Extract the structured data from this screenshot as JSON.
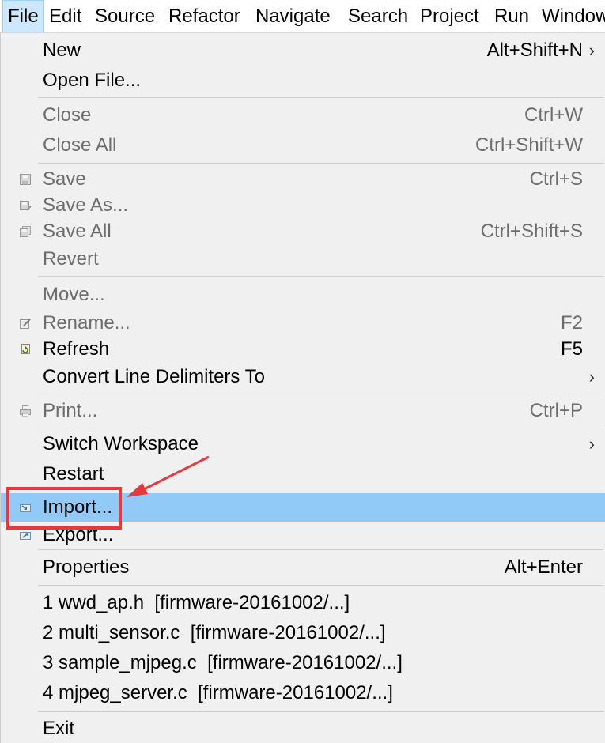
{
  "menubar": {
    "items": [
      "File",
      "Edit",
      "Source",
      "Refactor",
      "Navigate",
      "Search",
      "Project",
      "Run",
      "Window"
    ]
  },
  "menu": {
    "new": {
      "label": "New",
      "shortcut": "Alt+Shift+N"
    },
    "open_file": {
      "label": "Open File..."
    },
    "close": {
      "label": "Close",
      "shortcut": "Ctrl+W"
    },
    "close_all": {
      "label": "Close All",
      "shortcut": "Ctrl+Shift+W"
    },
    "save": {
      "label": "Save",
      "shortcut": "Ctrl+S"
    },
    "save_as": {
      "label": "Save As..."
    },
    "save_all": {
      "label": "Save All",
      "shortcut": "Ctrl+Shift+S"
    },
    "revert": {
      "label": "Revert"
    },
    "move": {
      "label": "Move..."
    },
    "rename": {
      "label": "Rename...",
      "shortcut": "F2"
    },
    "refresh": {
      "label": "Refresh",
      "shortcut": "F5"
    },
    "convert_line_delimiters": {
      "label": "Convert Line Delimiters To"
    },
    "print": {
      "label": "Print...",
      "shortcut": "Ctrl+P"
    },
    "switch_workspace": {
      "label": "Switch Workspace"
    },
    "restart": {
      "label": "Restart"
    },
    "import": {
      "label": "Import..."
    },
    "export": {
      "label": "Export..."
    },
    "properties": {
      "label": "Properties",
      "shortcut": "Alt+Enter"
    },
    "recent_files": [
      "1 wwd_ap.h  [firmware-20161002/...]",
      "2 multi_sensor.c  [firmware-20161002/...]",
      "3 sample_mjpeg.c  [firmware-20161002/...]",
      "4 mjpeg_server.c  [firmware-20161002/...]"
    ],
    "exit": {
      "label": "Exit"
    }
  },
  "colors": {
    "highlight": "#91c9f7",
    "annotation": "#e8383d",
    "menu_background": "#f0f0f0",
    "disabled_text": "#6d6d6d"
  },
  "icons": {
    "save": "save-icon",
    "save_as": "save-as-icon",
    "save_all": "save-all-icon",
    "rename": "rename-icon",
    "refresh": "refresh-icon",
    "print": "print-icon",
    "import": "import-icon",
    "export": "export-icon",
    "submenu": "chevron-right-icon"
  }
}
